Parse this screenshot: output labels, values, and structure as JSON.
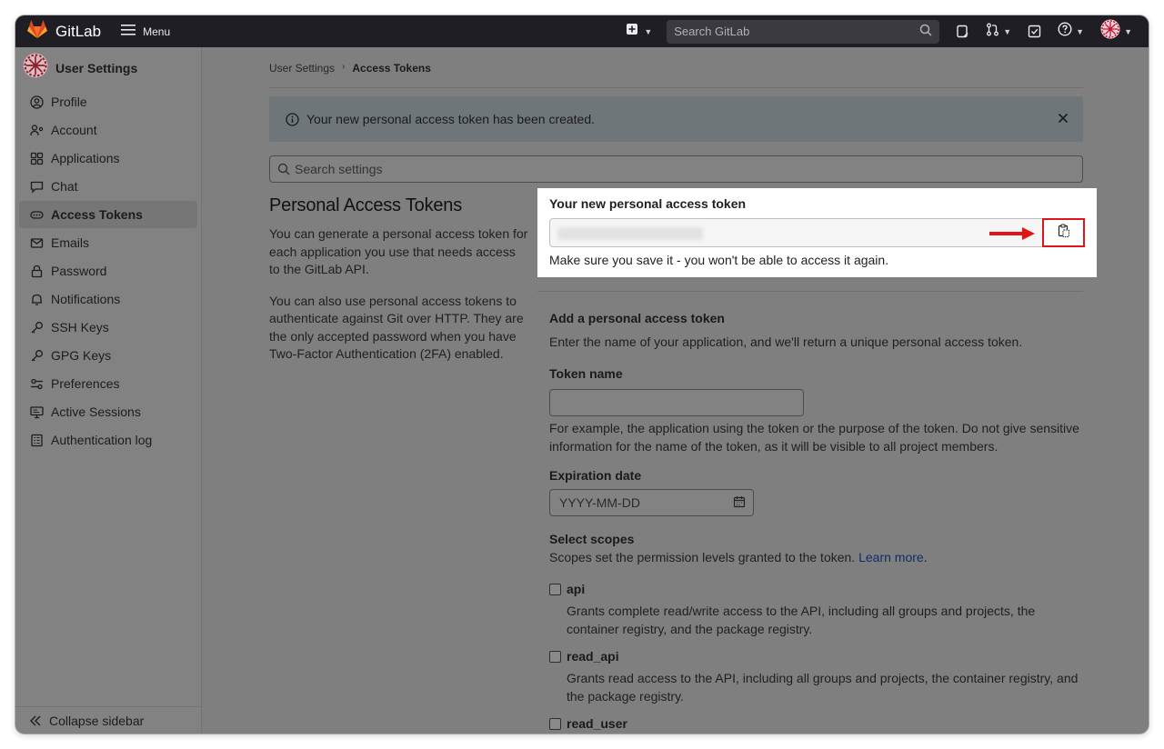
{
  "navbar": {
    "brand": "GitLab",
    "menu_label": "Menu",
    "search_placeholder": "Search GitLab"
  },
  "sidebar": {
    "title": "User Settings",
    "items": [
      {
        "label": "Profile",
        "icon": "profile-icon"
      },
      {
        "label": "Account",
        "icon": "account-icon"
      },
      {
        "label": "Applications",
        "icon": "applications-icon"
      },
      {
        "label": "Chat",
        "icon": "chat-icon"
      },
      {
        "label": "Access Tokens",
        "icon": "token-icon",
        "active": true
      },
      {
        "label": "Emails",
        "icon": "mail-icon"
      },
      {
        "label": "Password",
        "icon": "lock-icon"
      },
      {
        "label": "Notifications",
        "icon": "bell-icon"
      },
      {
        "label": "SSH Keys",
        "icon": "key-icon"
      },
      {
        "label": "GPG Keys",
        "icon": "key-icon"
      },
      {
        "label": "Preferences",
        "icon": "preferences-icon"
      },
      {
        "label": "Active Sessions",
        "icon": "monitor-icon"
      },
      {
        "label": "Authentication log",
        "icon": "log-icon"
      }
    ],
    "collapse_label": "Collapse sidebar"
  },
  "breadcrumb": {
    "parent": "User Settings",
    "current": "Access Tokens"
  },
  "alert": {
    "message": "Your new personal access token has been created."
  },
  "settings_search": {
    "placeholder": "Search settings"
  },
  "intro": {
    "heading": "Personal Access Tokens",
    "p1": "You can generate a personal access token for each application you use that needs access to the GitLab API.",
    "p2": "You can also use personal access tokens to authenticate against Git over HTTP. They are the only accepted password when you have Two-Factor Authentication (2FA) enabled."
  },
  "new_token": {
    "title": "Your new personal access token",
    "note": "Make sure you save it - you won't be able to access it again."
  },
  "form": {
    "title": "Add a personal access token",
    "description": "Enter the name of your application, and we'll return a unique personal access token.",
    "token_name_label": "Token name",
    "token_name_help": "For example, the application using the token or the purpose of the token. Do not give sensitive information for the name of the token, as it will be visible to all project members.",
    "expiration_label": "Expiration date",
    "expiration_placeholder": "YYYY-MM-DD",
    "scopes_label": "Select scopes",
    "scopes_help": "Scopes set the permission levels granted to the token.",
    "learn_more": "Learn more",
    "scopes": [
      {
        "name": "api",
        "desc": "Grants complete read/write access to the API, including all groups and projects, the container registry, and the package registry."
      },
      {
        "name": "read_api",
        "desc": "Grants read access to the API, including all groups and projects, the container registry, and the package registry."
      },
      {
        "name": "read_user",
        "desc": ""
      }
    ]
  },
  "colors": {
    "navbar": "#1f1e24",
    "highlight_box": "#e0151a",
    "arrow": "#e0151a",
    "overlay": "#7f7f7f"
  }
}
